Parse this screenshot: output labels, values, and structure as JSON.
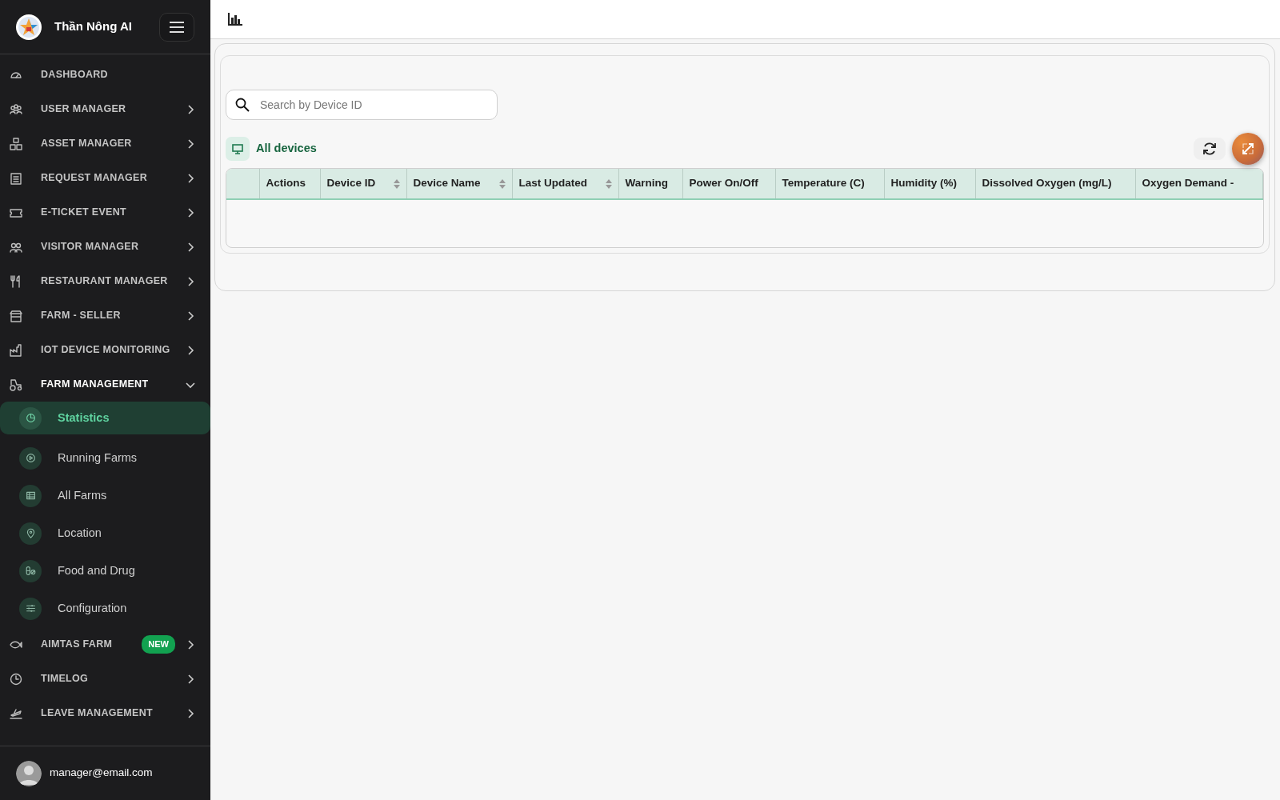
{
  "brand": {
    "name": "Thần Nông AI"
  },
  "sidebar": {
    "items": [
      {
        "label": "DASHBOARD",
        "kind": "gauge"
      },
      {
        "label": "USER MANAGER",
        "kind": "users",
        "expanded": false
      },
      {
        "label": "ASSET MANAGER",
        "kind": "boxes",
        "expanded": false
      },
      {
        "label": "REQUEST MANAGER",
        "kind": "clipboard",
        "expanded": false
      },
      {
        "label": "E-TICKET EVENT",
        "kind": "ticket",
        "expanded": false
      },
      {
        "label": "VISITOR MANAGER",
        "kind": "people",
        "expanded": false
      },
      {
        "label": "RESTAURANT MANAGER",
        "kind": "cutlery",
        "expanded": false
      },
      {
        "label": "FARM - SELLER",
        "kind": "store",
        "expanded": false
      },
      {
        "label": "IOT DEVICE MONITORING",
        "kind": "factory",
        "expanded": false
      },
      {
        "label": "FARM MANAGEMENT",
        "kind": "tractor",
        "expanded": true,
        "children": [
          {
            "label": "Statistics",
            "kind": "pie",
            "selected": true
          },
          {
            "label": "Running Farms",
            "kind": "play",
            "selected": false
          },
          {
            "label": "All Farms",
            "kind": "table",
            "selected": false
          },
          {
            "label": "Location",
            "kind": "pin",
            "selected": false
          },
          {
            "label": "Food and Drug",
            "kind": "pills",
            "selected": false
          },
          {
            "label": "Configuration",
            "kind": "sliders",
            "selected": false
          }
        ]
      },
      {
        "label": "AIMTAS FARM",
        "kind": "fish",
        "expanded": false,
        "badge": "NEW"
      },
      {
        "label": "TIMELOG",
        "kind": "clock",
        "expanded": false
      },
      {
        "label": "LEAVE MANAGEMENT",
        "kind": "plane",
        "expanded": false
      }
    ]
  },
  "user": {
    "email": "manager@email.com"
  },
  "search": {
    "placeholder": "Search by Device ID"
  },
  "section": {
    "title": "All devices"
  },
  "table": {
    "columns": [
      {
        "label": "Actions",
        "sortable": false
      },
      {
        "label": "Device ID",
        "sortable": true
      },
      {
        "label": "Device Name",
        "sortable": true
      },
      {
        "label": "Last Updated",
        "sortable": true
      },
      {
        "label": "Warning",
        "sortable": false
      },
      {
        "label": "Power On/Off",
        "sortable": false
      },
      {
        "label": "Temperature (C)",
        "sortable": false
      },
      {
        "label": "Humidity (%)",
        "sortable": false
      },
      {
        "label": "Dissolved Oxygen (mg/L)",
        "sortable": false
      },
      {
        "label": "Oxygen Demand -",
        "sortable": false
      }
    ]
  }
}
